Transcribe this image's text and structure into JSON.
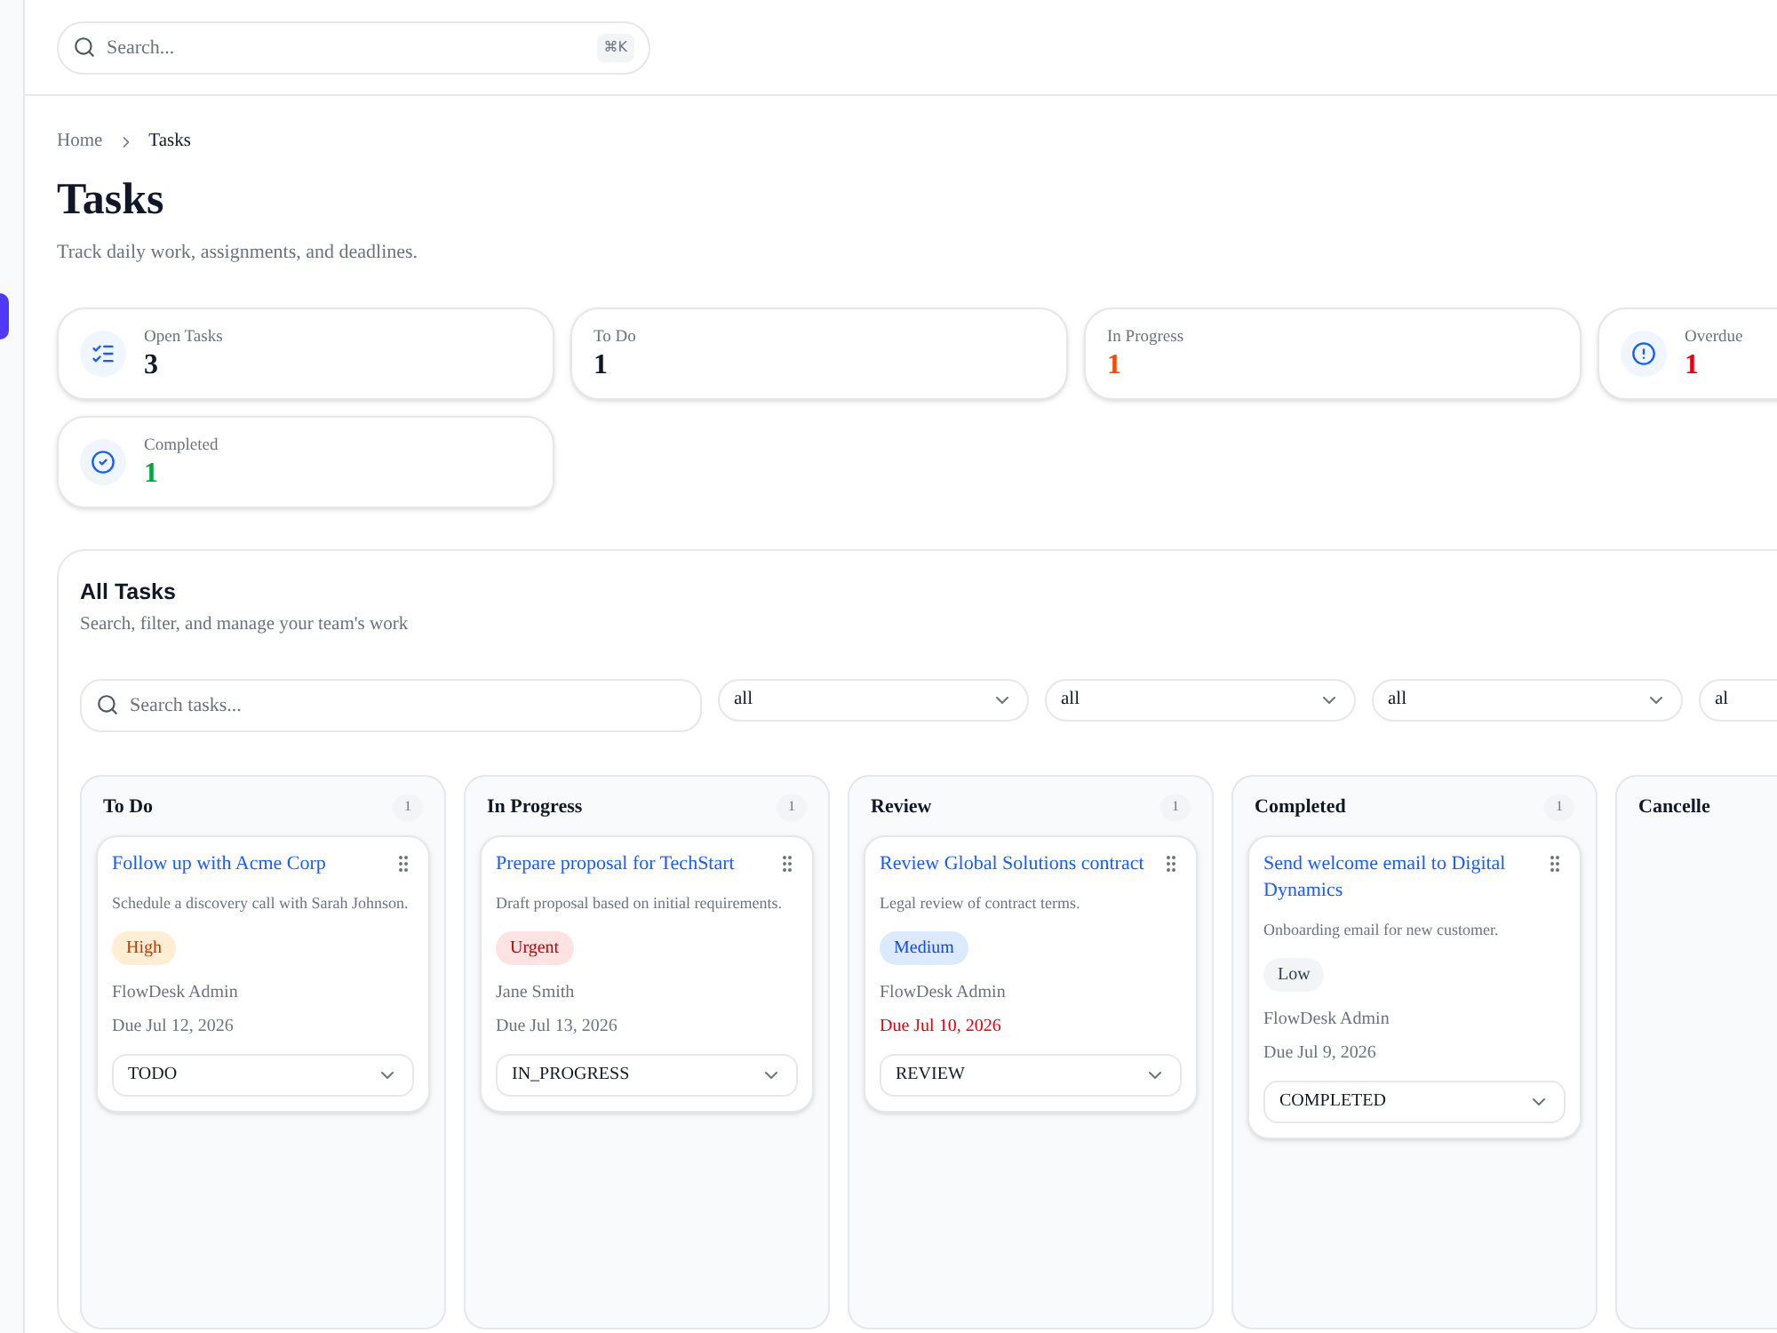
{
  "topbar": {
    "search": {
      "placeholder": "Search...",
      "shortcut": "⌘K"
    }
  },
  "breadcrumb": [
    "Home",
    "Tasks"
  ],
  "title": "Tasks",
  "subtitle": "Track daily work, assignments, and deadlines.",
  "stats": [
    {
      "label": "Open Tasks",
      "value": "3",
      "kind": "open"
    },
    {
      "label": "To Do",
      "value": "1",
      "kind": "todo"
    },
    {
      "label": "In Progress",
      "value": "1",
      "kind": "progress"
    },
    {
      "label": "Overdue",
      "value": "1",
      "kind": "overdue"
    },
    {
      "label": "Completed",
      "value": "1",
      "kind": "completed"
    }
  ],
  "panel": {
    "title": "All Tasks",
    "subtitle": "Search, filter, and manage your team's work",
    "search": {
      "placeholder": "Search tasks..."
    },
    "filters": [
      "all",
      "all",
      "all",
      "al"
    ],
    "columns": [
      {
        "title": "To Do",
        "count": "1",
        "cards": [
          {
            "title": "Follow up with Acme Corp",
            "description": "Schedule a discovery call with Sarah Johnson.",
            "priority": {
              "label": "High",
              "kind": "high"
            },
            "assignee": "FlowDesk Admin",
            "due": "Due Jul 12, 2026",
            "overdue": false,
            "status": "TODO"
          }
        ]
      },
      {
        "title": "In Progress",
        "count": "1",
        "cards": [
          {
            "title": "Prepare proposal for TechStart",
            "description": "Draft proposal based on initial requirements.",
            "priority": {
              "label": "Urgent",
              "kind": "urgent"
            },
            "assignee": "Jane Smith",
            "due": "Due Jul 13, 2026",
            "overdue": false,
            "status": "IN_PROGRESS"
          }
        ]
      },
      {
        "title": "Review",
        "count": "1",
        "cards": [
          {
            "title": "Review Global Solutions contract",
            "description": "Legal review of contract terms.",
            "priority": {
              "label": "Medium",
              "kind": "medium"
            },
            "assignee": "FlowDesk Admin",
            "due": "Due Jul 10, 2026",
            "overdue": true,
            "status": "REVIEW"
          }
        ]
      },
      {
        "title": "Completed",
        "count": "1",
        "cards": [
          {
            "title": "Send welcome email to Digital Dynamics",
            "description": "Onboarding email for new customer.",
            "priority": {
              "label": "Low",
              "kind": "low"
            },
            "assignee": "FlowDesk Admin",
            "due": "Due Jul 9, 2026",
            "overdue": false,
            "status": "COMPLETED"
          }
        ]
      },
      {
        "title": "Cancelle"
      }
    ]
  }
}
